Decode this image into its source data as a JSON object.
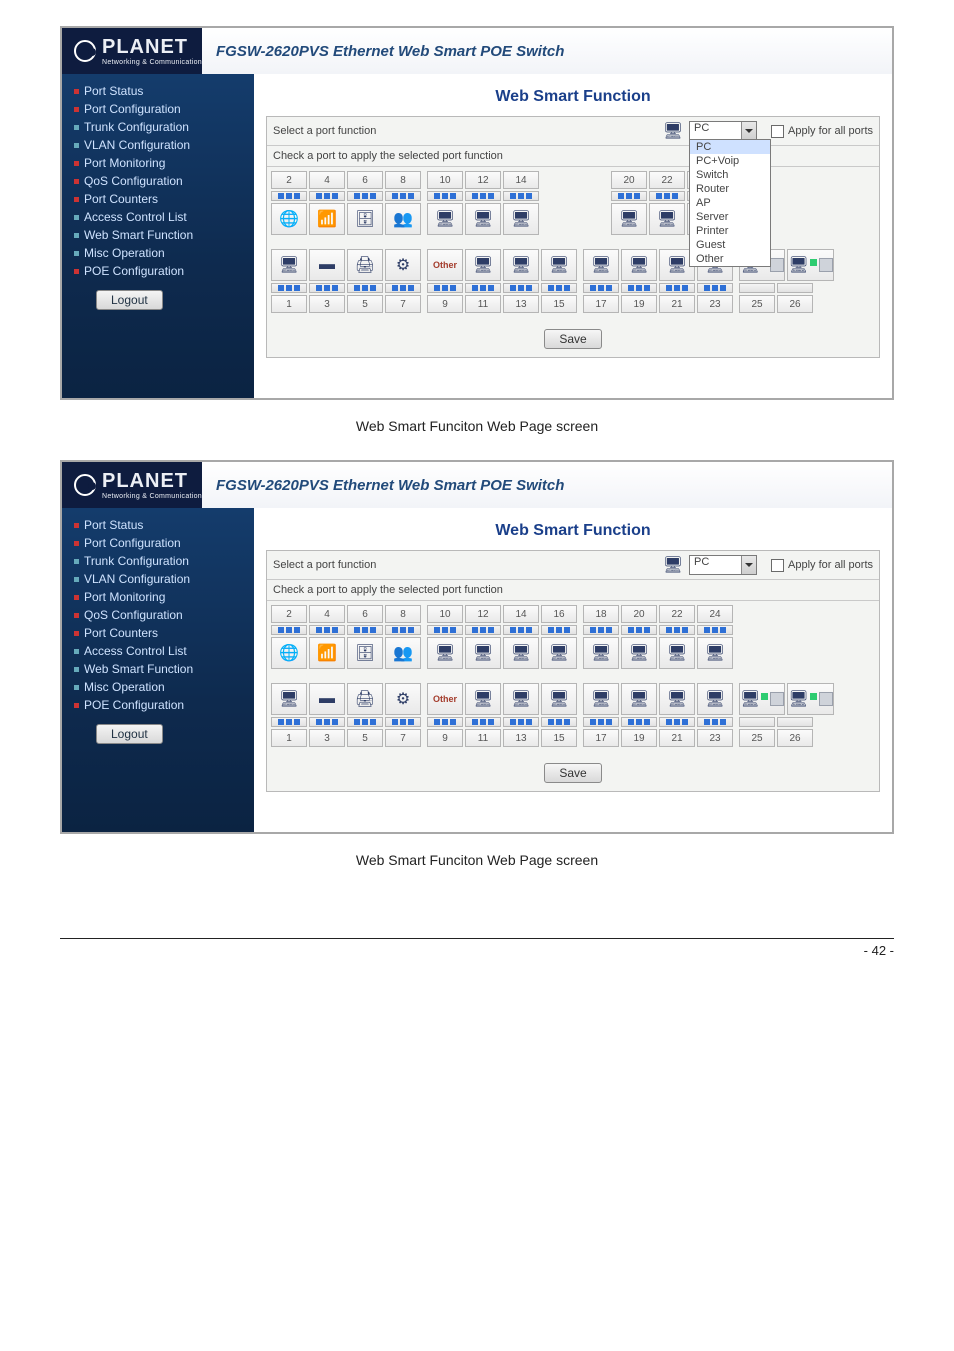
{
  "brand_name": "PLANET",
  "brand_sub": "Networking & Communication",
  "product_title": "FGSW-2620PVS Ethernet Web Smart POE Switch",
  "sidebar": {
    "items": [
      {
        "label": "Port Status"
      },
      {
        "label": "Port Configuration"
      },
      {
        "label": "Trunk Configuration"
      },
      {
        "label": "VLAN Configuration"
      },
      {
        "label": "Port Monitoring"
      },
      {
        "label": "QoS Configuration"
      },
      {
        "label": "Port Counters"
      },
      {
        "label": "Access Control List"
      },
      {
        "label": "Web Smart Function"
      },
      {
        "label": "Misc Operation"
      },
      {
        "label": "POE Configuration"
      }
    ],
    "logout": "Logout"
  },
  "main": {
    "heading": "Web Smart Function",
    "select_label": "Select a port function",
    "check_label": "Check a port to apply the selected port function",
    "apply_all": "Apply for all ports",
    "other": "Other",
    "save": "Save",
    "func_selected": "PC",
    "func_options": [
      "PC",
      "PC+Voip",
      "Switch",
      "Router",
      "AP",
      "Server",
      "Printer",
      "Guest",
      "Other"
    ]
  },
  "ports": {
    "top": [
      "2",
      "4",
      "6",
      "8",
      "10",
      "12",
      "14",
      "16",
      "18",
      "20",
      "22",
      "24"
    ],
    "bottom": [
      "1",
      "3",
      "5",
      "7",
      "9",
      "11",
      "13",
      "15",
      "17",
      "19",
      "21",
      "23",
      "25",
      "26"
    ]
  },
  "caption": "Web Smart Funciton Web Page screen",
  "page_number": "- 42 -"
}
